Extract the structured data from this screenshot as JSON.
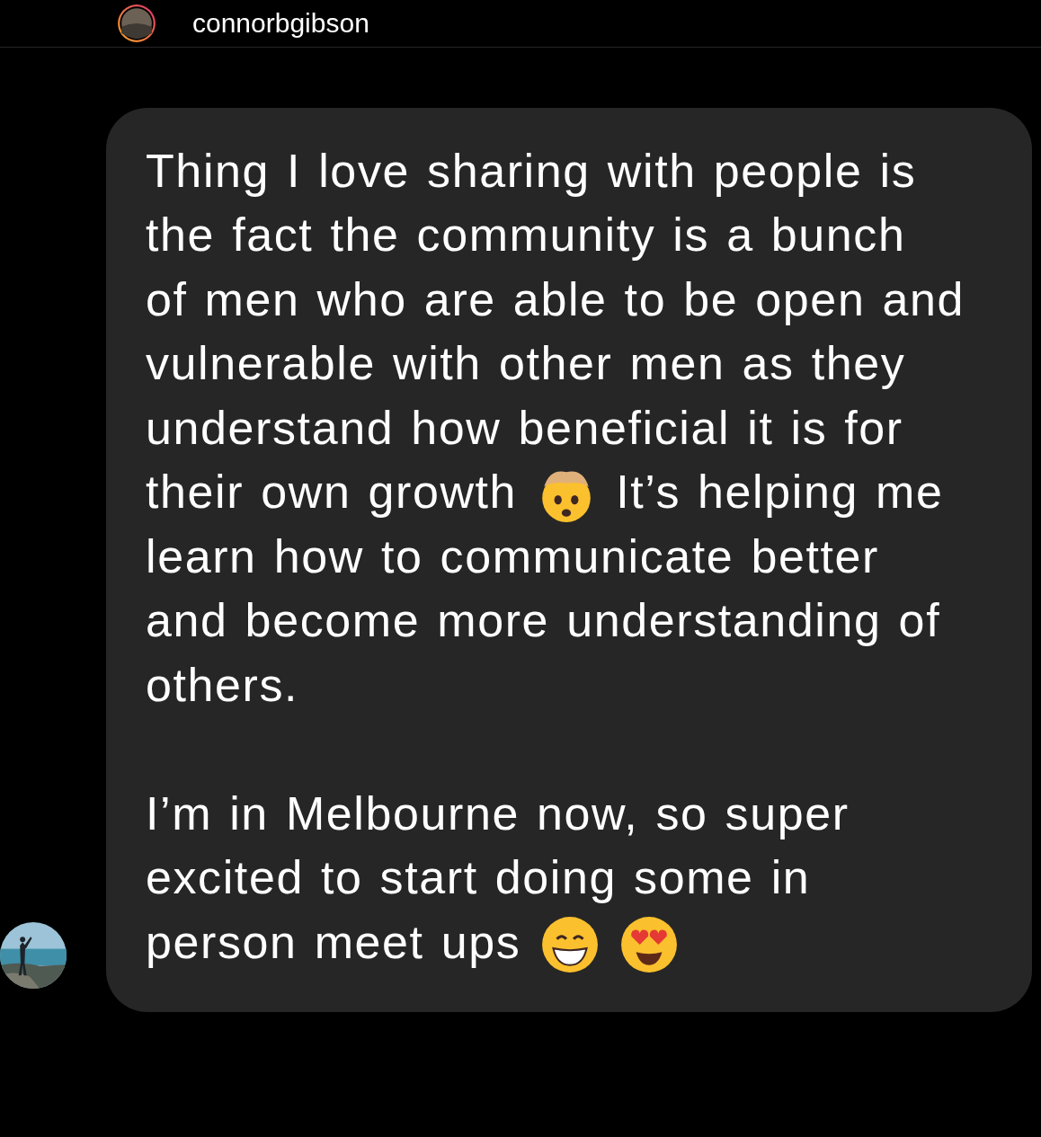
{
  "header": {
    "username": "connorbgibson"
  },
  "message": {
    "paragraphs": [
      [
        [
          {
            "kind": "text",
            "text": "Thing I love sharing with people is"
          }
        ],
        [
          {
            "kind": "text",
            "text": "the fact the community is a bunch"
          }
        ],
        [
          {
            "kind": "text",
            "text": "of men who are able to be open and"
          }
        ],
        [
          {
            "kind": "text",
            "text": "vulnerable with other men as they"
          }
        ],
        [
          {
            "kind": "text",
            "text": "understand how beneficial it is for"
          }
        ],
        [
          {
            "kind": "text",
            "text": "their own growth"
          },
          {
            "kind": "exploding-head"
          },
          {
            "kind": "text",
            "text": "It’s helping me"
          }
        ],
        [
          {
            "kind": "text",
            "text": "learn how to communicate better"
          }
        ],
        [
          {
            "kind": "text",
            "text": "and become more understanding of"
          }
        ],
        [
          {
            "kind": "text",
            "text": "others."
          }
        ]
      ],
      [
        [
          {
            "kind": "text",
            "text": "I’m in Melbourne now, so super"
          }
        ],
        [
          {
            "kind": "text",
            "text": "excited to start doing some in"
          }
        ],
        [
          {
            "kind": "text",
            "text": "person meet ups"
          },
          {
            "kind": "grin"
          },
          {
            "kind": "heart-eyes"
          }
        ]
      ]
    ]
  }
}
